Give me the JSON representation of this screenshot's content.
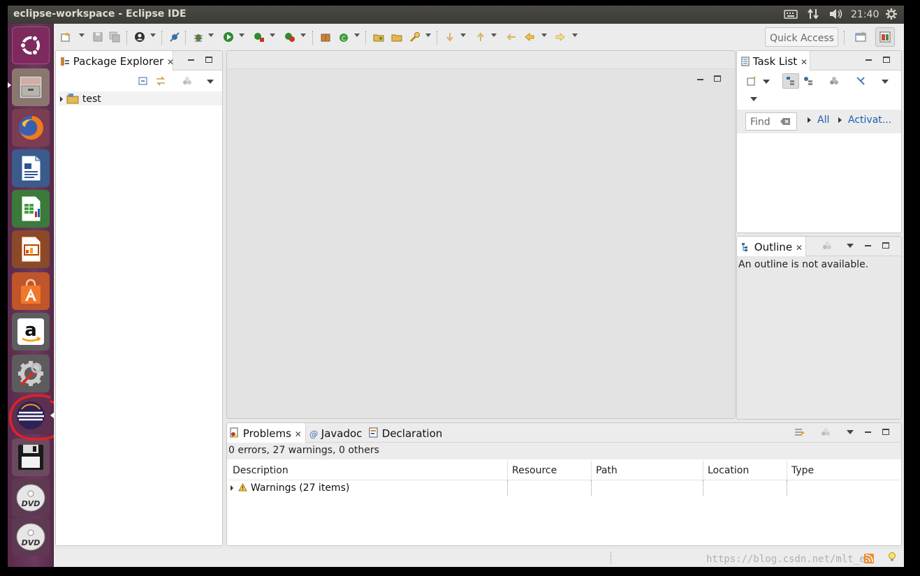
{
  "topbar": {
    "window_title": "eclipse-workspace - Eclipse IDE",
    "clock": "21:40",
    "tray_icons": [
      "keyboard-icon",
      "network-icon",
      "volume-icon",
      "settings-gear-icon"
    ]
  },
  "launcher": {
    "apps": [
      {
        "name": "ubuntu-dash",
        "icon": "ubuntu-logo-icon"
      },
      {
        "name": "files",
        "icon": "file-cabinet-icon"
      },
      {
        "name": "firefox",
        "icon": "firefox-icon"
      },
      {
        "name": "libreoffice-writer",
        "icon": "writer-doc-icon"
      },
      {
        "name": "libreoffice-calc",
        "icon": "calc-sheet-icon"
      },
      {
        "name": "libreoffice-impress",
        "icon": "impress-slide-icon"
      },
      {
        "name": "software-center",
        "icon": "shopping-bag-icon"
      },
      {
        "name": "amazon",
        "icon": "amazon-icon"
      },
      {
        "name": "system-settings",
        "icon": "settings-wrench-icon"
      },
      {
        "name": "eclipse",
        "icon": "eclipse-icon"
      },
      {
        "name": "save-disk",
        "icon": "floppy-disk-icon"
      },
      {
        "name": "dvd-1",
        "icon": "dvd-icon"
      },
      {
        "name": "dvd-2",
        "icon": "dvd-icon"
      }
    ],
    "dvd_label": "DVD",
    "amazon_label": "a"
  },
  "toolbar": {
    "quick_access": "Quick Access"
  },
  "package_explorer": {
    "tab_label": "Package Explorer",
    "tree": [
      {
        "label": "test",
        "icon": "java-project-icon"
      }
    ]
  },
  "task_list": {
    "tab_label": "Task List",
    "find_placeholder": "Find",
    "filter_all": "All",
    "filter_activate": "Activat..."
  },
  "outline": {
    "tab_label": "Outline",
    "message": "An outline is not available."
  },
  "problems_view": {
    "tabs": [
      {
        "label": "Problems",
        "icon": "problems-icon"
      },
      {
        "label": "Javadoc",
        "icon": "at-sign-icon"
      },
      {
        "label": "Declaration",
        "icon": "declaration-icon"
      }
    ],
    "summary": "0 errors, 27 warnings, 0 others",
    "columns": [
      "Description",
      "Resource",
      "Path",
      "Location",
      "Type"
    ],
    "rows": [
      {
        "description": "Warnings (27 items)",
        "icon": "warning-triangle-icon"
      }
    ]
  },
  "watermark": "https://blog.csdn.net/mlt_er",
  "colors": {
    "launcher_bg": "#6d3a5e",
    "topbar_bg": "#3c3b37",
    "link_blue": "#1e5db3",
    "annotation_red": "#e0202a"
  }
}
